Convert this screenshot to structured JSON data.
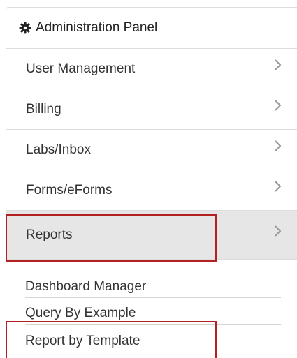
{
  "header": {
    "title": "Administration Panel",
    "icon": "gear-icon"
  },
  "menu": {
    "items": [
      {
        "label": "User Management",
        "icon": "chevron-right-icon"
      },
      {
        "label": "Billing",
        "icon": "chevron-right-icon"
      },
      {
        "label": "Labs/Inbox",
        "icon": "chevron-right-icon"
      },
      {
        "label": "Forms/eForms",
        "icon": "chevron-right-icon"
      },
      {
        "label": "Reports",
        "icon": "chevron-right-icon",
        "active": true
      }
    ]
  },
  "submenu": {
    "items": [
      {
        "label": "Dashboard Manager"
      },
      {
        "label": "Query By Example"
      },
      {
        "label": "Report by Template"
      }
    ]
  },
  "colors": {
    "highlight_border": "#b22222",
    "active_background": "#e6e6e6",
    "border": "#dddddd"
  }
}
